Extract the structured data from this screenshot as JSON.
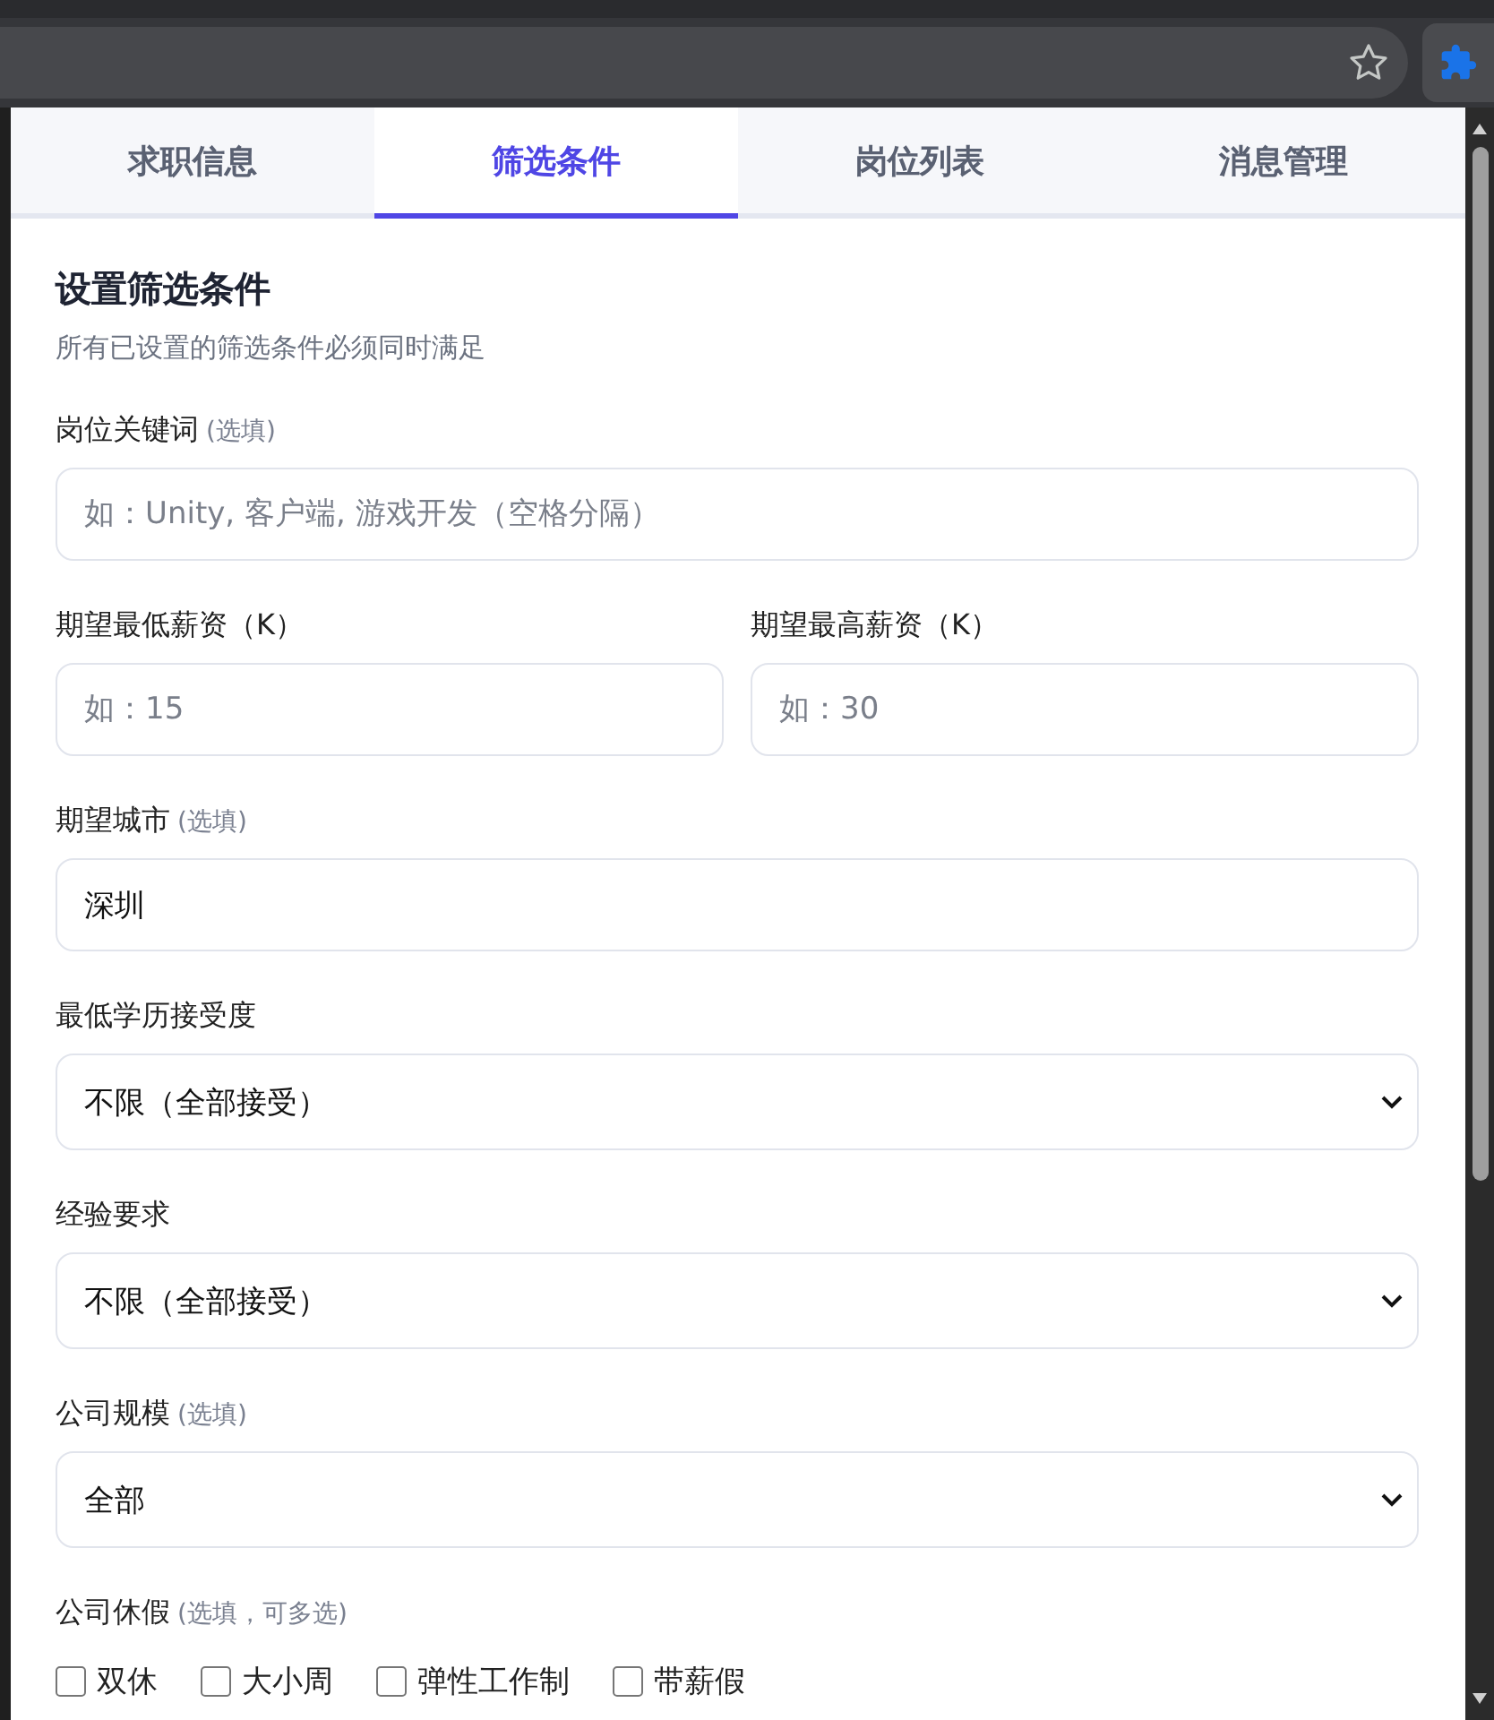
{
  "tabs": [
    {
      "label": "求职信息",
      "selected": false
    },
    {
      "label": "筛选条件",
      "selected": true
    },
    {
      "label": "岗位列表",
      "selected": false
    },
    {
      "label": "消息管理",
      "selected": false
    }
  ],
  "section": {
    "title": "设置筛选条件",
    "subtitle": "所有已设置的筛选条件必须同时满足"
  },
  "fields": [
    {
      "kind": "text",
      "label": "岗位关键词",
      "hint": "(选填)",
      "placeholder": "如：Unity, 客户端, 游戏开发（空格分隔）"
    },
    {
      "kind": "pair",
      "items": [
        {
          "label": "期望最低薪资（K）",
          "placeholder": "如：15"
        },
        {
          "label": "期望最高薪资（K）",
          "placeholder": "如：30"
        }
      ]
    },
    {
      "kind": "text",
      "label": "期望城市",
      "hint": "(选填)",
      "value": "深圳"
    },
    {
      "kind": "select",
      "label": "最低学历接受度",
      "value": "不限（全部接受）"
    },
    {
      "kind": "select",
      "label": "经验要求",
      "value": "不限（全部接受）"
    },
    {
      "kind": "select",
      "label": "公司规模",
      "hint": "(选填)",
      "value": "全部"
    },
    {
      "kind": "checkboxes",
      "label": "公司休假",
      "hint": "(选填，可多选)",
      "options": [
        {
          "label": "双休",
          "checked": false
        },
        {
          "label": "大小周",
          "checked": false
        },
        {
          "label": "弹性工作制",
          "checked": false
        },
        {
          "label": "带薪假",
          "checked": false
        }
      ]
    }
  ]
}
